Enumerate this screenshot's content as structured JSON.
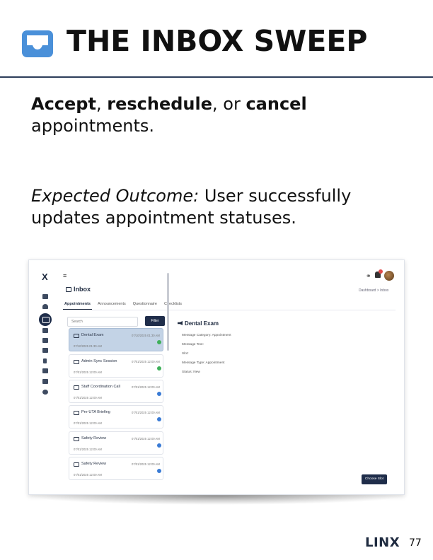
{
  "colors": {
    "header_icon": "#4a90d9",
    "rule": "#2c3e5a",
    "navy": "#1f2d4a",
    "selected_card": "#c3d3e6",
    "status_done": "#3fb05a",
    "status_pending": "#3a7bd5"
  },
  "header": {
    "title": "THE INBOX SWEEP",
    "icon": "inbox-tray-icon"
  },
  "lead": {
    "accept": "Accept",
    "sep1": ", ",
    "reschedule": "reschedule",
    "sep2": ", or ",
    "cancel": "cancel",
    "rest": "appointments."
  },
  "outcome": {
    "label": "Expected Outcome:",
    "text": " User successfully updates appointment statuses."
  },
  "app": {
    "logo": "X",
    "breadcrumb": "Dashboard > Inbox",
    "page_title": "Inbox",
    "tabs": [
      {
        "label": "Appointments",
        "active": true
      },
      {
        "label": "Announcements",
        "active": false
      },
      {
        "label": "Questionnaire",
        "active": false
      },
      {
        "label": "Checklists",
        "active": false
      }
    ],
    "search_placeholder": "Search",
    "filter_label": "Filter",
    "cards": [
      {
        "title": "Dental Exam",
        "date": "07/10/2025 01:30 AM",
        "time": "07/10/2025 01:30 AM",
        "status": "done",
        "selected": true
      },
      {
        "title": "Admin Sync Session",
        "date": "07/01/2025 12:00 AM",
        "time": "07/01/2025 12:00 AM",
        "status": "done",
        "selected": false
      },
      {
        "title": "Staff Coordination Call",
        "date": "07/01/2025 12:00 AM",
        "time": "07/01/2025 12:00 AM",
        "status": "pending",
        "selected": false
      },
      {
        "title": "Pre-UTA Briefing",
        "date": "07/01/2025 12:00 AM",
        "time": "07/01/2025 12:00 AM",
        "status": "pending",
        "selected": false
      },
      {
        "title": "Safety Review",
        "date": "07/01/2025 12:00 AM",
        "time": "07/01/2025 12:00 AM",
        "status": "pending",
        "selected": false
      },
      {
        "title": "Safety Review",
        "date": "07/01/2025 12:00 AM",
        "time": "07/01/2025 12:00 AM",
        "status": "pending",
        "selected": false
      }
    ],
    "detail": {
      "title": "Dental Exam",
      "lines": [
        "Message Category: Appointment",
        "Message Text:",
        "Slot:",
        "Message Type: Appointment",
        "Status: New"
      ],
      "choose_slot": "Choose Slot"
    }
  },
  "footer": {
    "brand": "LINX",
    "page": "77"
  }
}
